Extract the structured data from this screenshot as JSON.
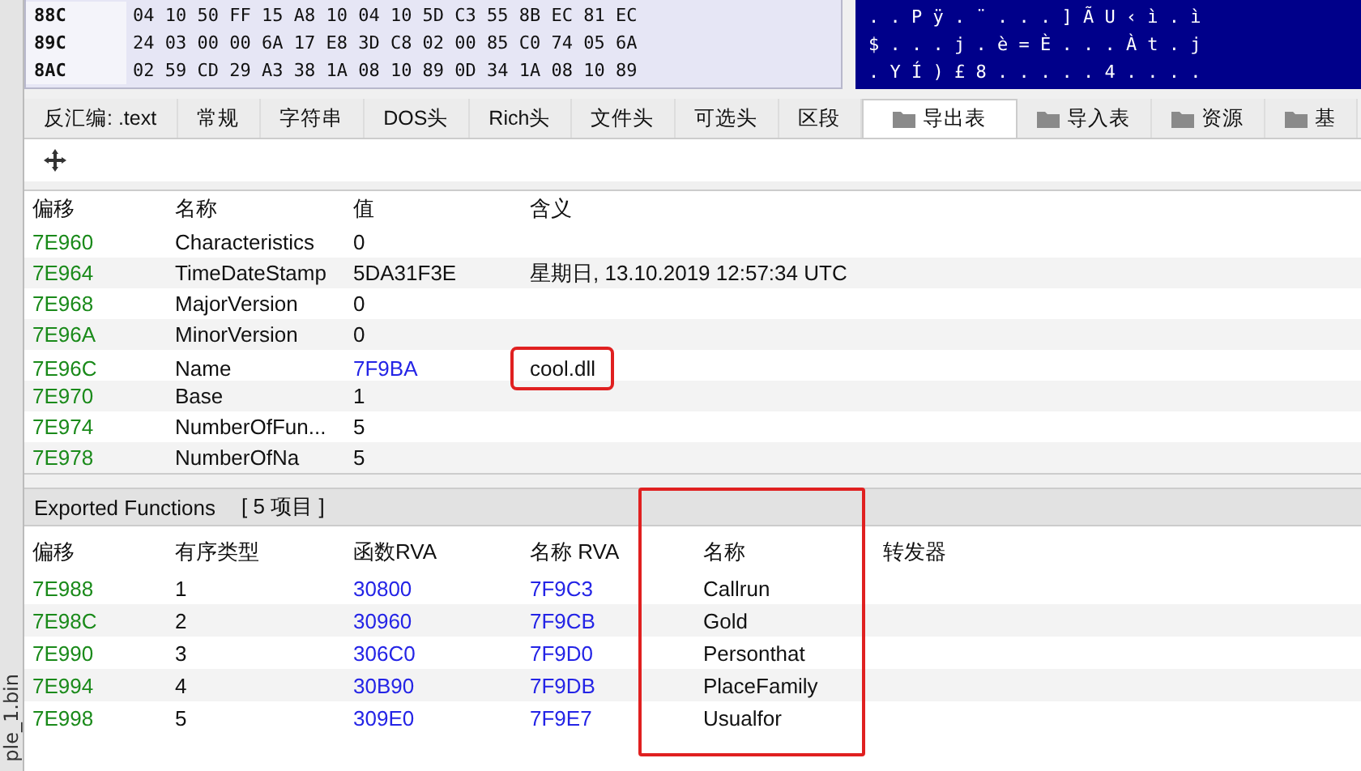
{
  "hex_view": {
    "rows": [
      {
        "offset": "88C",
        "bytes": "04 10 50 FF 15 A8 10 04 10 5D C3 55 8B EC 81 EC",
        "ascii": ". . P ÿ . ¨ . . . ] Ã U ‹ ì . ì"
      },
      {
        "offset": "89C",
        "bytes": "24 03 00 00 6A 17 E8 3D C8 02 00 85 C0 74 05 6A",
        "ascii": "$ . . . j . è = È . . . À t . j"
      },
      {
        "offset": "8AC",
        "bytes": "02 59 CD 29 A3 38 1A 08 10 89 0D 34 1A 08 10 89",
        "ascii": ". Y Í ) £ 8 . . . . . 4 . . . ."
      }
    ]
  },
  "side_label": "ple_1.bin",
  "tabs": [
    {
      "label": "反汇编: .text",
      "selected": false,
      "folder": false
    },
    {
      "label": "常规",
      "selected": false,
      "folder": false
    },
    {
      "label": "字符串",
      "selected": false,
      "folder": false
    },
    {
      "label": "DOS头",
      "selected": false,
      "folder": false
    },
    {
      "label": "Rich头",
      "selected": false,
      "folder": false
    },
    {
      "label": "文件头",
      "selected": false,
      "folder": false
    },
    {
      "label": "可选头",
      "selected": false,
      "folder": false
    },
    {
      "label": "区段",
      "selected": false,
      "folder": false
    },
    {
      "label": "导出表",
      "selected": true,
      "folder": true
    },
    {
      "label": "导入表",
      "selected": false,
      "folder": true
    },
    {
      "label": "资源",
      "selected": false,
      "folder": true
    },
    {
      "label": "基",
      "selected": false,
      "folder": true
    }
  ],
  "directory_table": {
    "columns": [
      "偏移",
      "名称",
      "值",
      "含义"
    ],
    "rows": [
      {
        "offset": "7E960",
        "name": "Characteristics",
        "value": "0",
        "value_link": false,
        "meaning": "",
        "highlighted": false
      },
      {
        "offset": "7E964",
        "name": "TimeDateStamp",
        "value": "5DA31F3E",
        "value_link": false,
        "meaning": "星期日, 13.10.2019 12:57:34 UTC",
        "highlighted": false
      },
      {
        "offset": "7E968",
        "name": "MajorVersion",
        "value": "0",
        "value_link": false,
        "meaning": "",
        "highlighted": false
      },
      {
        "offset": "7E96A",
        "name": "MinorVersion",
        "value": "0",
        "value_link": false,
        "meaning": "",
        "highlighted": false
      },
      {
        "offset": "7E96C",
        "name": "Name",
        "value": "7F9BA",
        "value_link": true,
        "meaning": "cool.dll",
        "highlighted": true
      },
      {
        "offset": "7E970",
        "name": "Base",
        "value": "1",
        "value_link": false,
        "meaning": "",
        "highlighted": false
      },
      {
        "offset": "7E974",
        "name": "NumberOfFun...",
        "value": "5",
        "value_link": false,
        "meaning": "",
        "highlighted": false
      },
      {
        "offset": "7E978",
        "name": "NumberOfNa",
        "value": "5",
        "value_link": false,
        "meaning": "",
        "highlighted": false
      }
    ]
  },
  "exported_functions": {
    "title": "Exported Functions",
    "count": "[ 5 项目 ]",
    "columns": [
      {
        "label": "偏移",
        "highlighted": false
      },
      {
        "label": "有序类型",
        "highlighted": false
      },
      {
        "label": "函数RVA",
        "highlighted": false
      },
      {
        "label": "名称 RVA",
        "highlighted": false
      },
      {
        "label": "名称",
        "highlighted": true
      },
      {
        "label": "转发器",
        "highlighted": false
      }
    ],
    "rows": [
      {
        "offset": "7E988",
        "ordinal": "1",
        "function_rva": "30800",
        "name_rva": "7F9C3",
        "name": "Callrun"
      },
      {
        "offset": "7E98C",
        "ordinal": "2",
        "function_rva": "30960",
        "name_rva": "7F9CB",
        "name": "Gold"
      },
      {
        "offset": "7E990",
        "ordinal": "3",
        "function_rva": "306C0",
        "name_rva": "7F9D0",
        "name": "Personthat"
      },
      {
        "offset": "7E994",
        "ordinal": "4",
        "function_rva": "30B90",
        "name_rva": "7F9DB",
        "name": "PlaceFamily"
      },
      {
        "offset": "7E998",
        "ordinal": "5",
        "function_rva": "309E0",
        "name_rva": "7F9E7",
        "name": "Usualfor"
      }
    ]
  }
}
